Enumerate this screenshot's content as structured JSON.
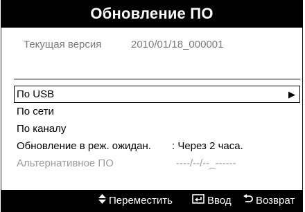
{
  "dialog": {
    "title": "Обновление ПО"
  },
  "version": {
    "label": "Текущая версия",
    "value": "2010/01/18_000001"
  },
  "menu": {
    "items": [
      {
        "label": "По USB",
        "arrow": "▶"
      },
      {
        "label": "По сети"
      },
      {
        "label": "По каналу"
      },
      {
        "label": "Обновление в реж. ожидан.",
        "value": ": Через 2 часа."
      },
      {
        "label": "Альтернативное ПО",
        "value": "----/--/--_------"
      }
    ]
  },
  "footer": {
    "move_icon": "updown-arrows-icon",
    "move_label": "Переместить",
    "enter_icon": "enter-icon",
    "enter_label": "Ввод",
    "back_icon": "return-icon",
    "back_label": "Возврат"
  },
  "colors": {
    "bar_background": "#000000",
    "disabled_text": "#9a9a9a",
    "secondary_text": "#7a7a7a"
  }
}
